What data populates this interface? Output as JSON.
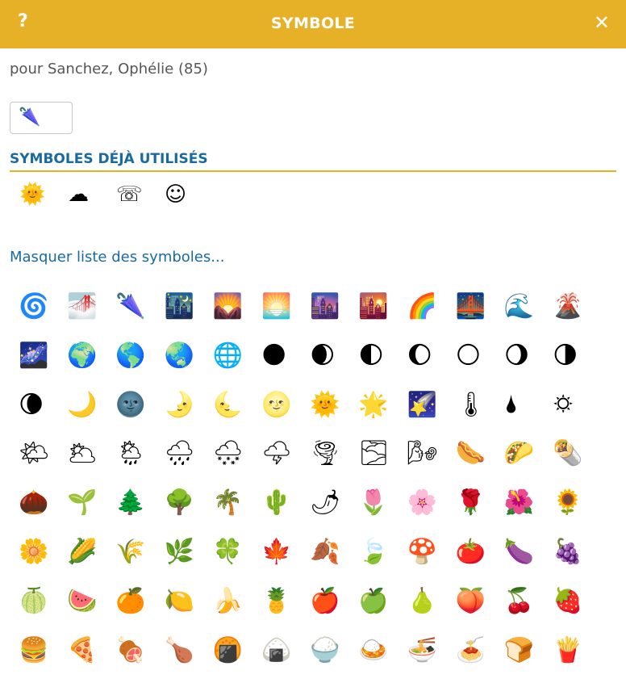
{
  "dialog": {
    "title": "SYMBOLE",
    "help_label": "?",
    "close_label": "✕",
    "subtitle": "pour Sanchez, Ophélie (85)",
    "selected_symbol": "🌂"
  },
  "used_symbols": {
    "heading": "SYMBOLES DÉJÀ UTILISÉS",
    "items": [
      "🌞",
      "☁",
      "☏",
      "☺"
    ]
  },
  "toggle_label": "Masquer liste des symboles...",
  "symbol_grid": [
    "🌀",
    "🌁",
    "🌂",
    "🌃",
    "🌄",
    "🌅",
    "🌆",
    "🌇",
    "🌈",
    "🌉",
    "🌊",
    "🌋",
    "🌌",
    "🌍",
    "🌎",
    "🌏",
    "🌐",
    "🌑",
    "🌒",
    "🌓",
    "🌔",
    "🌕",
    "🌖",
    "🌗",
    "🌘",
    "🌙",
    "🌚",
    "🌛",
    "🌜",
    "🌝",
    "🌞",
    "🌟",
    "🌠",
    "🌡",
    "🌢",
    "🌣",
    "🌤",
    "🌥",
    "🌦",
    "🌧",
    "🌨",
    "🌩",
    "🌪",
    "🌫",
    "🌬",
    "🌭",
    "🌮",
    "🌯",
    "🌰",
    "🌱",
    "🌲",
    "🌳",
    "🌴",
    "🌵",
    "🌶",
    "🌷",
    "🌸",
    "🌹",
    "🌺",
    "🌻",
    "🌼",
    "🌽",
    "🌾",
    "🌿",
    "🍀",
    "🍁",
    "🍂",
    "🍃",
    "🍄",
    "🍅",
    "🍆",
    "🍇",
    "🍈",
    "🍉",
    "🍊",
    "🍋",
    "🍌",
    "🍍",
    "🍎",
    "🍏",
    "🍐",
    "🍑",
    "🍒",
    "🍓",
    "🍔",
    "🍕",
    "🍖",
    "🍗",
    "🍘",
    "🍙",
    "🍚",
    "🍛",
    "🍜",
    "🍝",
    "🍞",
    "🍟"
  ]
}
